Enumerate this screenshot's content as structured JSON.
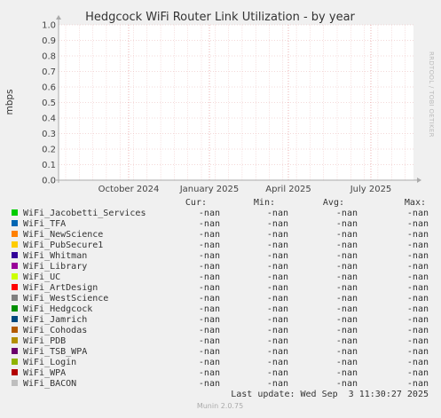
{
  "chart_data": {
    "type": "line",
    "title": "Hedgcock WiFi Router Link Utilization - by year",
    "ylabel": "mbps",
    "xlabel": "",
    "ylim": [
      0,
      1.0
    ],
    "yticks": [
      "0.0",
      "0.1",
      "0.2",
      "0.3",
      "0.4",
      "0.5",
      "0.6",
      "0.7",
      "0.8",
      "0.9",
      "1.0"
    ],
    "xticks": [
      "October 2024",
      "January 2025",
      "April 2025",
      "July 2025"
    ],
    "grid": true,
    "watermark": "RRDTOOL / TOBI OETIKER",
    "legend_headers": [
      "Cur:",
      "Min:",
      "Avg:",
      "Max:"
    ],
    "series": [
      {
        "name": "WiFi_Jacobetti_Services",
        "color": "#00cc00",
        "cur": "-nan",
        "min": "-nan",
        "avg": "-nan",
        "max": "-nan"
      },
      {
        "name": "WiFi_TFA",
        "color": "#0066b3",
        "cur": "-nan",
        "min": "-nan",
        "avg": "-nan",
        "max": "-nan"
      },
      {
        "name": "WiFi_NewScience",
        "color": "#ff8000",
        "cur": "-nan",
        "min": "-nan",
        "avg": "-nan",
        "max": "-nan"
      },
      {
        "name": "WiFi_PubSecure1",
        "color": "#ffcc00",
        "cur": "-nan",
        "min": "-nan",
        "avg": "-nan",
        "max": "-nan"
      },
      {
        "name": "WiFi_Whitman",
        "color": "#330099",
        "cur": "-nan",
        "min": "-nan",
        "avg": "-nan",
        "max": "-nan"
      },
      {
        "name": "WiFi_Library",
        "color": "#990099",
        "cur": "-nan",
        "min": "-nan",
        "avg": "-nan",
        "max": "-nan"
      },
      {
        "name": "WiFi_UC",
        "color": "#ccff00",
        "cur": "-nan",
        "min": "-nan",
        "avg": "-nan",
        "max": "-nan"
      },
      {
        "name": "WiFi_ArtDesign",
        "color": "#ff0000",
        "cur": "-nan",
        "min": "-nan",
        "avg": "-nan",
        "max": "-nan"
      },
      {
        "name": "WiFi_WestScience",
        "color": "#808080",
        "cur": "-nan",
        "min": "-nan",
        "avg": "-nan",
        "max": "-nan"
      },
      {
        "name": "WiFi_Hedgcock",
        "color": "#008f00",
        "cur": "-nan",
        "min": "-nan",
        "avg": "-nan",
        "max": "-nan"
      },
      {
        "name": "WiFi_Jamrich",
        "color": "#00487d",
        "cur": "-nan",
        "min": "-nan",
        "avg": "-nan",
        "max": "-nan"
      },
      {
        "name": "WiFi_Cohodas",
        "color": "#b35a00",
        "cur": "-nan",
        "min": "-nan",
        "avg": "-nan",
        "max": "-nan"
      },
      {
        "name": "WiFi_PDB",
        "color": "#b38f00",
        "cur": "-nan",
        "min": "-nan",
        "avg": "-nan",
        "max": "-nan"
      },
      {
        "name": "WiFi_TSB_WPA",
        "color": "#6b006b",
        "cur": "-nan",
        "min": "-nan",
        "avg": "-nan",
        "max": "-nan"
      },
      {
        "name": "WiFi_Login",
        "color": "#8fb300",
        "cur": "-nan",
        "min": "-nan",
        "avg": "-nan",
        "max": "-nan"
      },
      {
        "name": "WiFi_WPA",
        "color": "#b30000",
        "cur": "-nan",
        "min": "-nan",
        "avg": "-nan",
        "max": "-nan"
      },
      {
        "name": "WiFi_BACON",
        "color": "#bebebe",
        "cur": "-nan",
        "min": "-nan",
        "avg": "-nan",
        "max": "-nan"
      }
    ],
    "last_update": "Last update: Wed Sep  3 11:30:27 2025",
    "footer": "Munin 2.0.75"
  }
}
